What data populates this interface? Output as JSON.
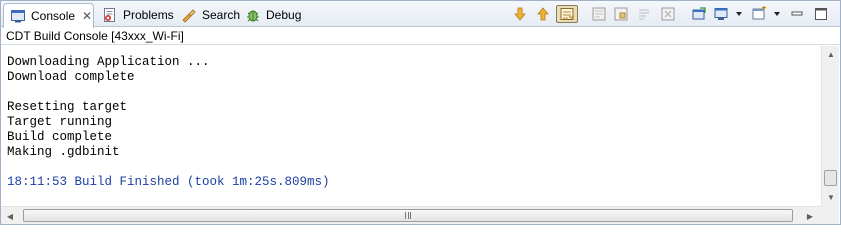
{
  "tabs": [
    {
      "label": "Console",
      "icon": "console-icon",
      "active": true
    },
    {
      "label": "Problems",
      "icon": "problems-icon",
      "active": false
    },
    {
      "label": "Search",
      "icon": "search-icon",
      "active": false
    },
    {
      "label": "Debug",
      "icon": "debug-icon",
      "active": false
    }
  ],
  "toolbar": {
    "icons": [
      "scroll-down-icon",
      "scroll-up-icon",
      "scroll-lock-icon",
      "clear-console-icon",
      "pin-console-icon",
      "word-wrap-icon",
      "remove-launch-icon",
      "open-console-icon",
      "display-console-icon",
      "new-console-icon",
      "minimize-icon",
      "maximize-icon"
    ],
    "scroll_lock_pressed": true
  },
  "console": {
    "title": "CDT Build Console [43xxx_Wi-Fi]",
    "lines": [
      "Downloading Application ...",
      "Download complete",
      "",
      "Resetting target",
      "Target running",
      "Build complete",
      "Making .gdbinit",
      "",
      "18:11:53 Build Finished (took 1m:25s.809ms)"
    ]
  },
  "colors": {
    "finished_text": "#1c3fa3",
    "tab_border": "#a9bad0"
  }
}
